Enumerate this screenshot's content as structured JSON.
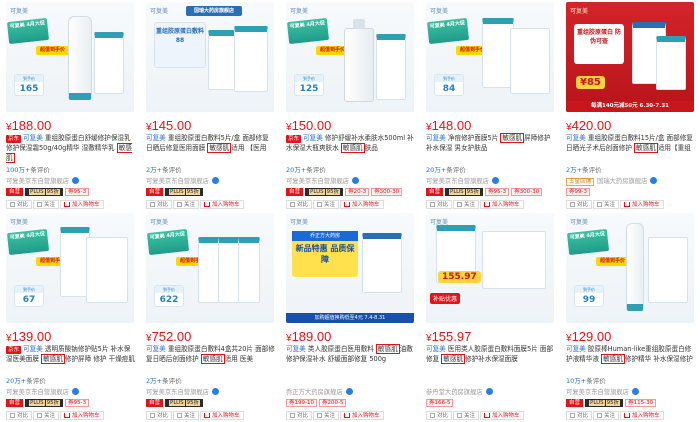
{
  "products": [
    {
      "price": "188.00",
      "title_prefix": "可复美",
      "title_main": " 重组胶原蛋白舒缓修护保湿乳修护保湿霜50g/40g精华 湿敷精华乳 ",
      "title_hl": "敏感肌",
      "title_tag": "",
      "reviews_count": "100万+",
      "reviews_label": "条评价",
      "shop": "可复美京东自营旗舰店",
      "shop_tag": "",
      "badges": [
        "自营",
        "PLUS",
        "95折",
        "券95-3"
      ],
      "image": {
        "sale_badge": "可复美 4月大促",
        "ribbon": "超值到手价",
        "tag_label": "到手价",
        "tag_value": "165",
        "promo": ""
      }
    },
    {
      "price": "145.00",
      "title_prefix": "可复美",
      "title_main": " 重组胶原蛋白敷料5片/盒 面部修复 日晒后修复医用面膜 ",
      "title_hl": "敏感肌",
      "title_tag": "适用 【医用",
      "reviews_count": "2万+",
      "reviews_label": "条评价",
      "shop": "可复美京东自营旗舰店",
      "shop_tag": "",
      "badges": [
        "自营",
        "PLUS",
        "95折"
      ],
      "image": {
        "sale_badge": "国瑞大药房旗舰店",
        "ribbon": "",
        "tag_label": "",
        "tag_value": "",
        "promo": "重组胶原蛋白敷料 88"
      }
    },
    {
      "price": "150.00",
      "title_prefix": "可复美",
      "title_main": " 修护舒缓补水柔肤水500ml 补水保湿大瓶爽肤水 ",
      "title_hl": "敏感肌",
      "title_tag": "肤品",
      "reviews_count": "20万+",
      "reviews_label": "条评价",
      "shop": "可复美京东自营旗舰店",
      "shop_tag": "",
      "badges": [
        "自营",
        "PLUS",
        "95折",
        "券20-3",
        "券300-30"
      ],
      "image": {
        "sale_badge": "可复美 4月大促",
        "ribbon": "超值到手价",
        "tag_label": "到手价",
        "tag_value": "125",
        "promo": ""
      }
    },
    {
      "price": "148.00",
      "title_prefix": "可复美",
      "title_main": " 净痘修护面膜5片 ",
      "title_hl": "敏感肌",
      "title_tag": "屏障修护补水保湿 男女护肤品",
      "reviews_count": "20万+",
      "reviews_label": "条评价",
      "shop": "可复美京东自营旗舰店",
      "shop_tag": "",
      "badges": [
        "自营",
        "PLUS",
        "95折",
        "券95-3",
        "券300-30"
      ],
      "image": {
        "sale_badge": "可复美 4月大促",
        "ribbon": "超值到手价",
        "tag_label": "到手价",
        "tag_value": "84",
        "promo": ""
      }
    },
    {
      "price": "420.00",
      "title_prefix": "可复美",
      "title_main": " 重组胶原蛋白敷料15片/盒 面部修复日晒光子术后创面修护 ",
      "title_hl": "敏感肌",
      "title_tag": "适用【重组",
      "reviews_count": "2万+",
      "reviews_label": "条评价",
      "shop": "国瑞大药房旗舰店",
      "shop_tag": "五星店铺",
      "badges": [
        "券99-3"
      ],
      "image": {
        "sale_badge": "",
        "ribbon": "",
        "tag_label": "",
        "tag_value": "",
        "promo": "重组胶原蛋白 防伪可查",
        "big_price": "¥85",
        "strip": "每满140元减50元 6.30-7.31"
      }
    },
    {
      "price": "139.00",
      "title_prefix": "可复美",
      "title_main": " 透明质酸钠修护贴5片 补水保湿医美面膜 ",
      "title_hl": "敏感肌",
      "title_tag": "修护屏障 修护 干燥痘肌",
      "reviews_count": "20万+",
      "reviews_label": "条评价",
      "shop": "可复美京东自营旗舰店",
      "shop_tag": "",
      "badges": [
        "自营",
        "PLUS",
        "95折",
        "券95-3"
      ],
      "image": {
        "sale_badge": "可复美 4月大促",
        "ribbon": "超值到手价",
        "tag_label": "到手价",
        "tag_value": "67",
        "promo": ""
      }
    },
    {
      "price": "752.00",
      "title_prefix": "可复美",
      "title_main": " 重组胶原蛋白敷料4盒共20片 面部修复日晒后创面修护 ",
      "title_hl": "敏感肌",
      "title_tag": "适用 医美",
      "reviews_count": "2万+",
      "reviews_label": "条评价",
      "shop": "可复美京东自营旗舰店",
      "shop_tag": "",
      "badges": [
        "自营",
        "PLUS",
        "95折"
      ],
      "image": {
        "sale_badge": "可复美 4月大促",
        "ribbon": "超值到手价",
        "tag_label": "到手价",
        "tag_value": "622",
        "promo": ""
      }
    },
    {
      "price": "189.00",
      "title_prefix": "可复美",
      "title_main": " 类人胶原蛋白医用敷料 ",
      "title_hl": "敏感肌",
      "title_tag": "油敷修护保湿补水 舒缓面部修复 500g",
      "reviews_count": "",
      "reviews_label": "",
      "shop": "乔正方大药房旗舰店",
      "shop_tag": "",
      "badges": [
        "券199-10",
        "券200-5"
      ],
      "image": {
        "sale_badge": "",
        "ribbon": "",
        "tag_label": "",
        "tag_value": "",
        "promo": "",
        "guard_top": "乔正方大药房",
        "guard_main": "新品特惠 品质保障",
        "strip": "加购超值换购低至4元 7.4-8.31"
      }
    },
    {
      "price": "155.97",
      "title_prefix": "可复美",
      "title_main": " 医用类人胶原蛋白敷料面膜5片 面部修复 ",
      "title_hl": "敏感肌",
      "title_tag": "修护补水保湿面膜",
      "reviews_count": "",
      "reviews_label": "",
      "shop": "参丹堂大药房旗舰店",
      "shop_tag": "",
      "badges": [
        "券166-5"
      ],
      "image": {
        "sale_badge": "",
        "ribbon": "",
        "tag_label": "",
        "tag_value": "",
        "promo": "",
        "big_price": "155.97",
        "buzhi": "补贴优惠"
      }
    },
    {
      "price": "129.00",
      "title_prefix": "可复美",
      "title_main": " 胶原棒Human-like重组胶原蛋白修护液精华液 ",
      "title_hl": "敏感肌",
      "title_tag": "修护精华 补水保湿修护",
      "reviews_count": "10万+",
      "reviews_label": "条评价",
      "shop": "可复美京东自营旗舰店",
      "shop_tag": "",
      "badges": [
        "自营",
        "PLUS",
        "95折",
        "券115-30"
      ],
      "image": {
        "sale_badge": "可复美 4月大促",
        "ribbon": "超值到手价",
        "tag_label": "到手价",
        "tag_value": "99",
        "promo": ""
      }
    }
  ],
  "actions": {
    "compare": "对比",
    "follow": "关注",
    "cart": "加入购物车"
  },
  "brand_logo": "可复美",
  "jd_tag": "京东",
  "plus_suffix": "95折",
  "colors": {
    "price_red": "#e3131a",
    "highlight_box": "#e3131a",
    "link_blue": "#2a6fd2"
  }
}
